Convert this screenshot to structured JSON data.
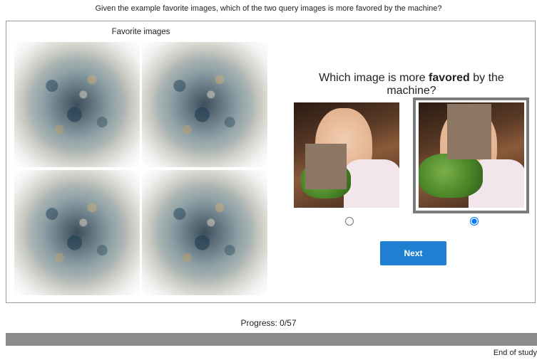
{
  "instruction": "Given the example favorite images, which of the two query images is more favored by the machine?",
  "favorites": {
    "title": "Favorite images",
    "images": [
      {
        "name": "favorite-image-1"
      },
      {
        "name": "favorite-image-2"
      },
      {
        "name": "favorite-image-3"
      },
      {
        "name": "favorite-image-4"
      }
    ]
  },
  "question": {
    "prefix": "Which image is more ",
    "emphasis": "favored",
    "suffix": " by the machine?"
  },
  "queries": [
    {
      "name": "query-image-left",
      "selected": false
    },
    {
      "name": "query-image-right",
      "selected": true
    }
  ],
  "next_label": "Next",
  "progress": {
    "text": "Progress: 0/57",
    "current": 0,
    "total": 57
  },
  "end_label": "End of study",
  "colors": {
    "accent": "#1f7fd0",
    "progress_track": "#8c8c8c",
    "selected_border": "#7a7a7a",
    "mask": "#8b7763"
  }
}
